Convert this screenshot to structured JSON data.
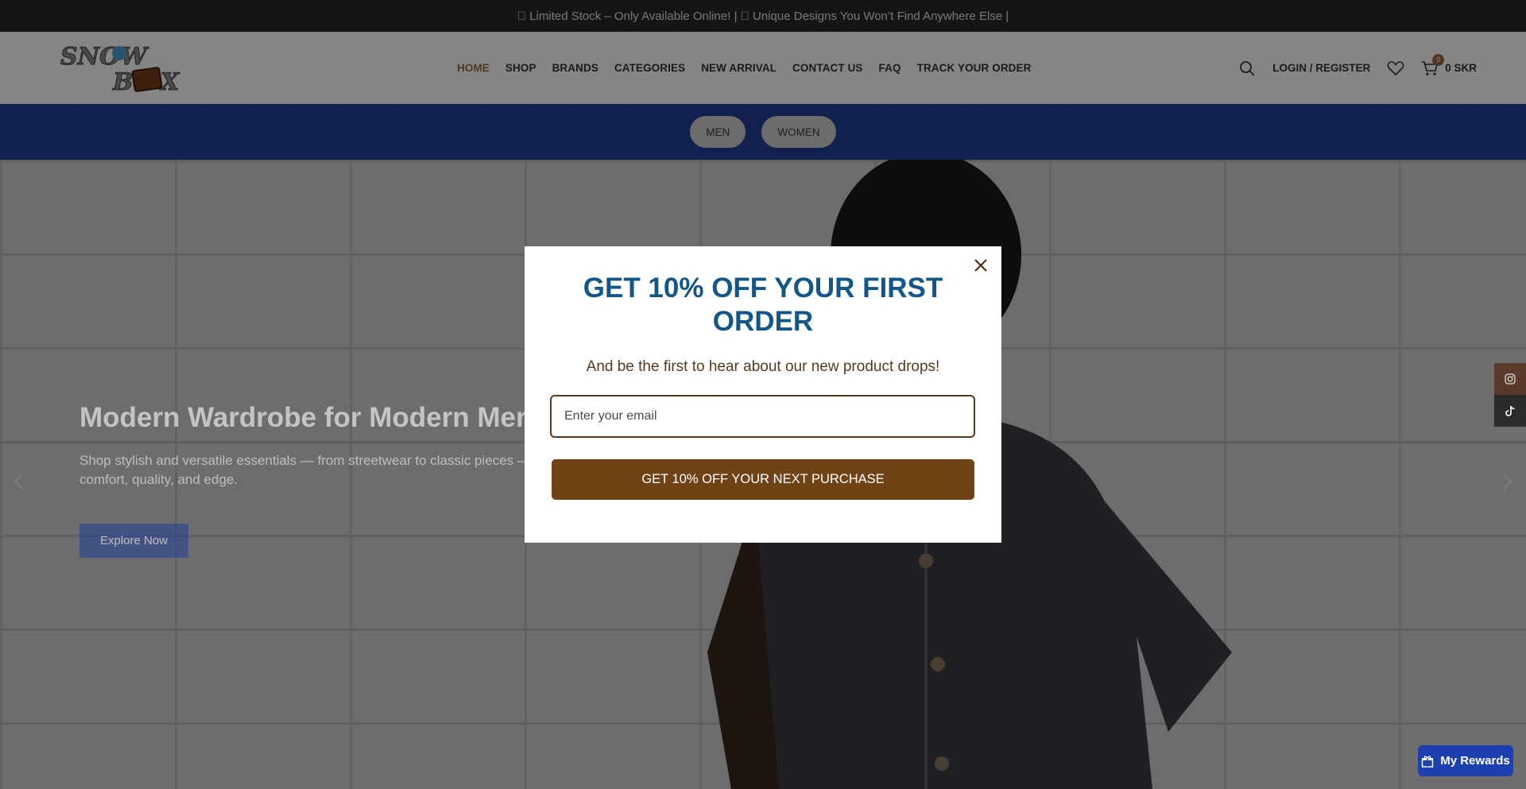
{
  "announcement": " Limited Stock – Only Available Online! |  Unique Designs You Won’t Find Anywhere Else |",
  "brand": {
    "logo_text": "SNOW BOX"
  },
  "nav": {
    "items": [
      {
        "label": "HOME",
        "active": true
      },
      {
        "label": "SHOP"
      },
      {
        "label": "BRANDS"
      },
      {
        "label": "CATEGORIES"
      },
      {
        "label": "NEW ARRIVAL"
      },
      {
        "label": "CONTACT US"
      },
      {
        "label": "FAQ"
      },
      {
        "label": "TRACK YOUR ORDER"
      }
    ]
  },
  "header": {
    "login_label": "LOGIN / REGISTER",
    "cart_count": "0",
    "cart_total": "0 SKR"
  },
  "gender": {
    "men": "MEN",
    "women": "WOMEN"
  },
  "hero": {
    "title": "Modern Wardrobe for Modern Men",
    "subtitle": "Shop stylish and versatile essentials — from streetwear to classic pieces — de comfort, quality, and edge.",
    "cta": "Explore Now"
  },
  "modal": {
    "title": "GET 10% OFF YOUR FIRST ORDER",
    "subtitle": "And be the first to hear about our new product drops!",
    "email_placeholder": "Enter your email",
    "button_label": "GET 10% OFF YOUR NEXT PURCHASE"
  },
  "rewards": {
    "label": "My Rewards"
  },
  "colors": {
    "accent": "#9a6b3f",
    "brand_blue": "#223f97",
    "modal_title": "#135688",
    "modal_button": "#6f4316",
    "rewards_blue": "#1d3fb0"
  }
}
